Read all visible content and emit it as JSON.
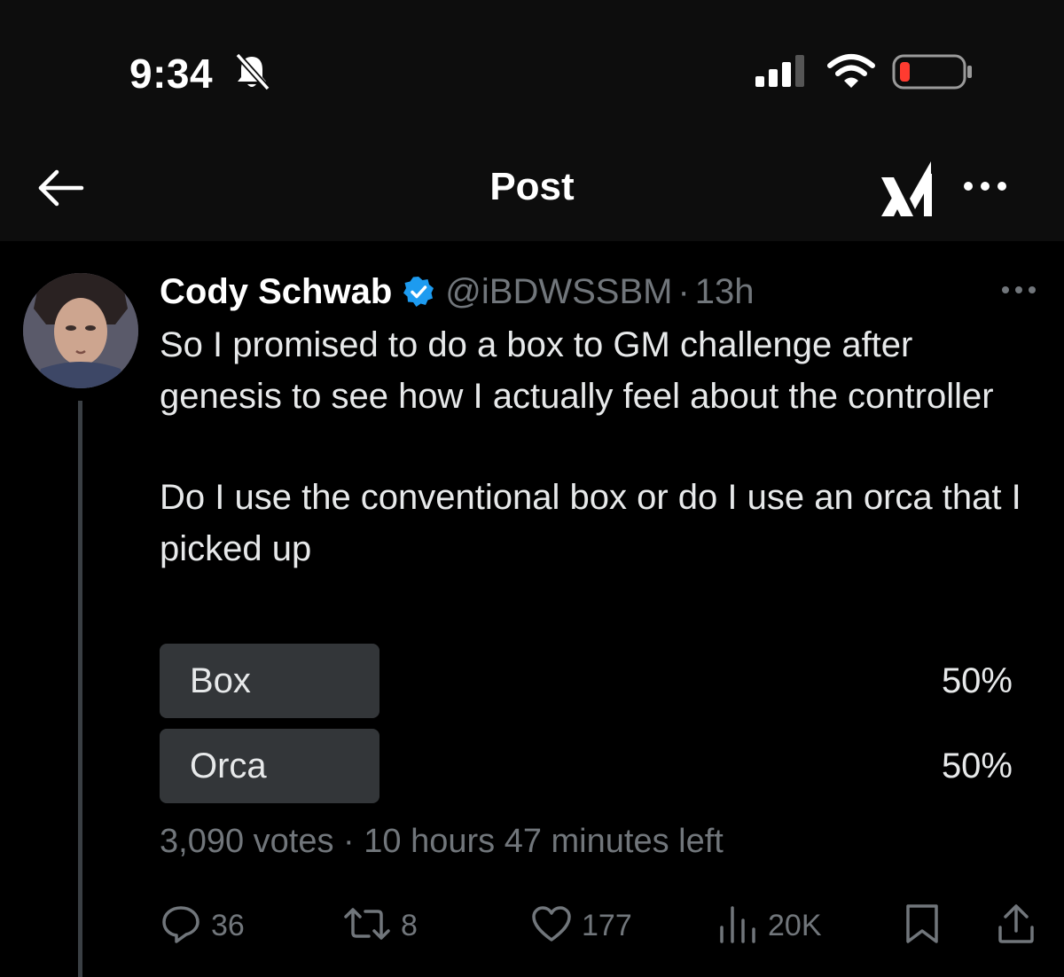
{
  "status_bar": {
    "time": "9:34",
    "icons": [
      "bell-slash-icon",
      "signal-icon",
      "wifi-icon",
      "battery-low-icon"
    ],
    "battery_color": "#ff3b30"
  },
  "nav": {
    "title": "Post",
    "back_icon": "arrow-left-icon",
    "brand_icon": "xai-logo-icon",
    "more_icon": "more-horizontal-icon"
  },
  "post": {
    "author_name": "Cody Schwab",
    "verified": true,
    "verified_color": "#1d9bf0",
    "handle": "@iBDWSSBM",
    "separator": "·",
    "time_ago": "13h",
    "paragraphs": [
      "So I promised to do a box to GM challenge after genesis to see how I actually feel about the controller",
      "Do I use the conventional box or do I use an orca that I picked up"
    ],
    "poll": {
      "options": [
        {
          "label": "Box",
          "percent": "50%",
          "fill": 0.5
        },
        {
          "label": "Orca",
          "percent": "50%",
          "fill": 0.5
        }
      ],
      "votes": "3,090 votes",
      "separator": "·",
      "time_left": "10 hours 47 minutes left"
    },
    "actions": {
      "replies": "36",
      "reposts": "8",
      "likes": "177",
      "views": "20K"
    }
  }
}
